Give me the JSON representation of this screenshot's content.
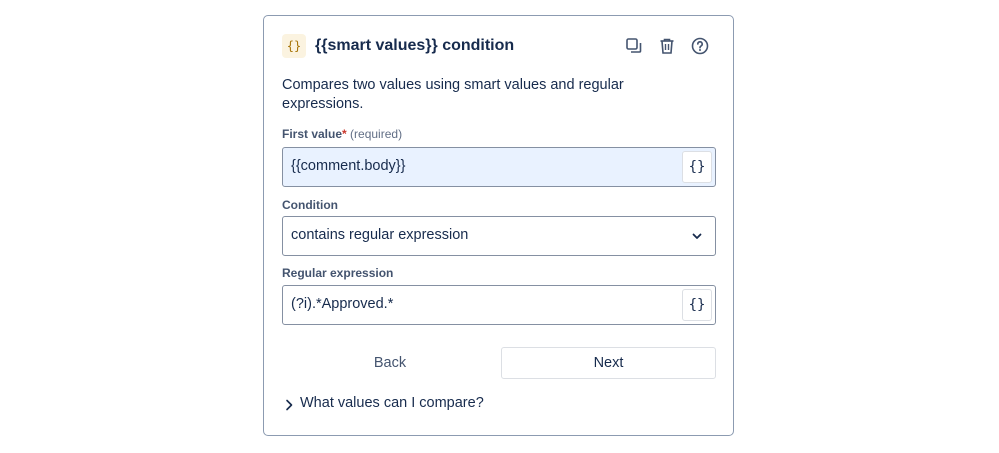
{
  "header": {
    "icon_glyph": "{}",
    "icon_name": "curly-braces-icon",
    "title": "{{smart values}} condition",
    "actions": [
      "duplicate-icon",
      "trash-icon",
      "help-icon"
    ]
  },
  "description": "Compares two values using smart values and regular expressions.",
  "first_value": {
    "label": "First value",
    "required_mark": "*",
    "required_text": "(required)",
    "value": "{{comment.body}}",
    "smart_value_button": "{}"
  },
  "condition": {
    "label": "Condition",
    "selected": "contains regular expression"
  },
  "regex": {
    "label": "Regular expression",
    "value": "(?i).*Approved.*",
    "smart_value_button": "{}"
  },
  "buttons": {
    "back": "Back",
    "next": "Next"
  },
  "expander": {
    "label": "What values can I compare?"
  },
  "colors": {
    "focused_field_bg": "#e9f2ff",
    "required_star": "#c9372c",
    "icon_bg": "#fbf3e0",
    "icon_fg": "#a8760a"
  }
}
